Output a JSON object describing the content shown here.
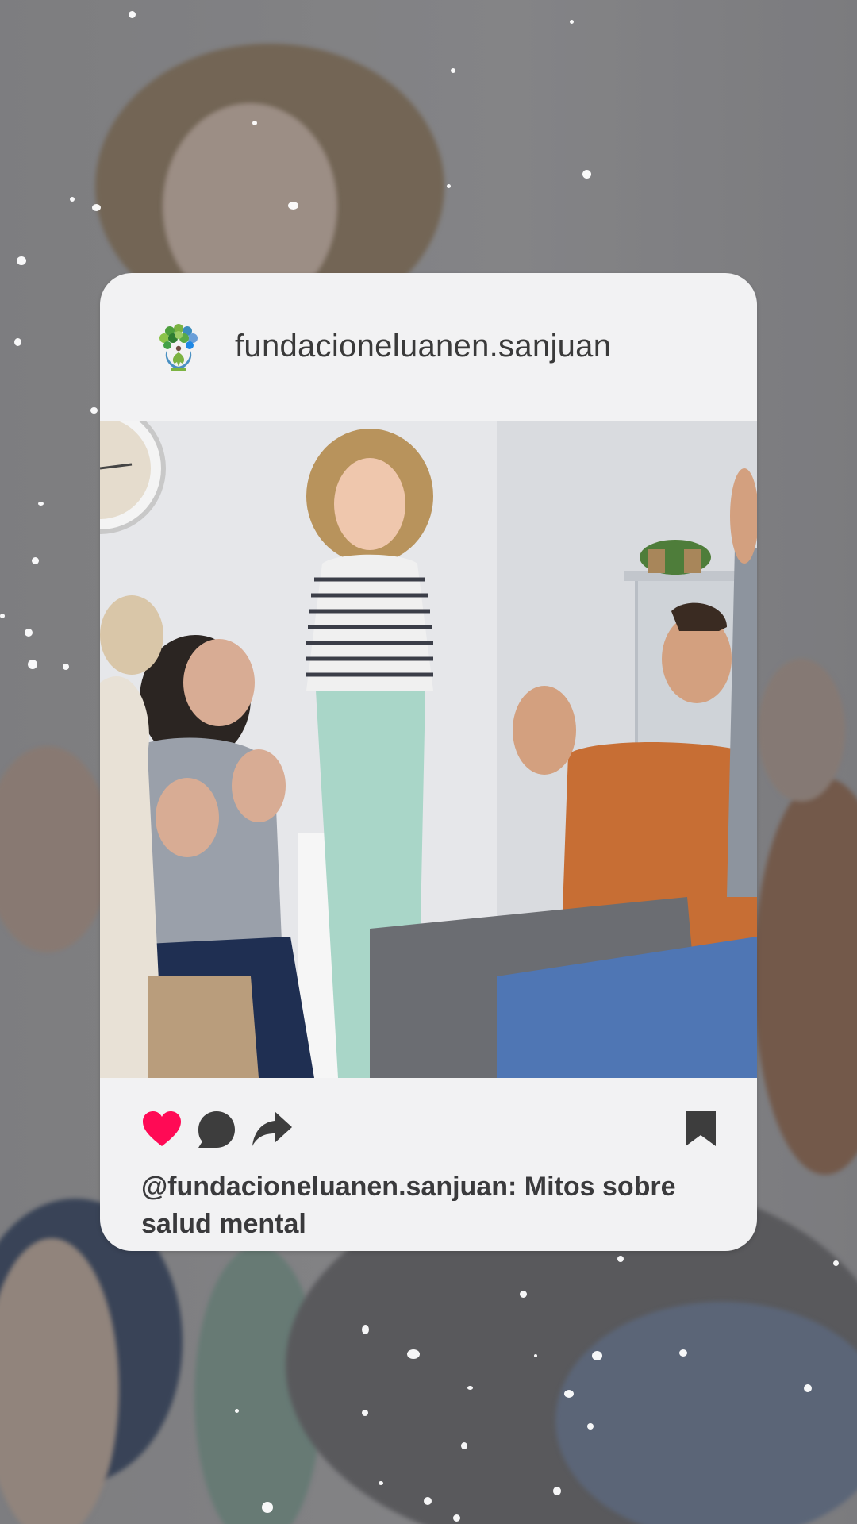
{
  "post": {
    "username": "fundacioneluanen.sanjuan",
    "caption": "@fundacioneluanen.sanjuan: Mitos sobre salud mental",
    "liked": true
  },
  "icons": {
    "like": "heart-icon",
    "comment": "comment-icon",
    "share": "share-arrow-icon",
    "save": "bookmark-icon",
    "logo": "tree-person-logo-icon"
  },
  "colors": {
    "like": "#ff0a55",
    "icon_dark": "#3d3d3d",
    "card_bg": "#f2f2f3",
    "text": "#3a3a3a"
  }
}
